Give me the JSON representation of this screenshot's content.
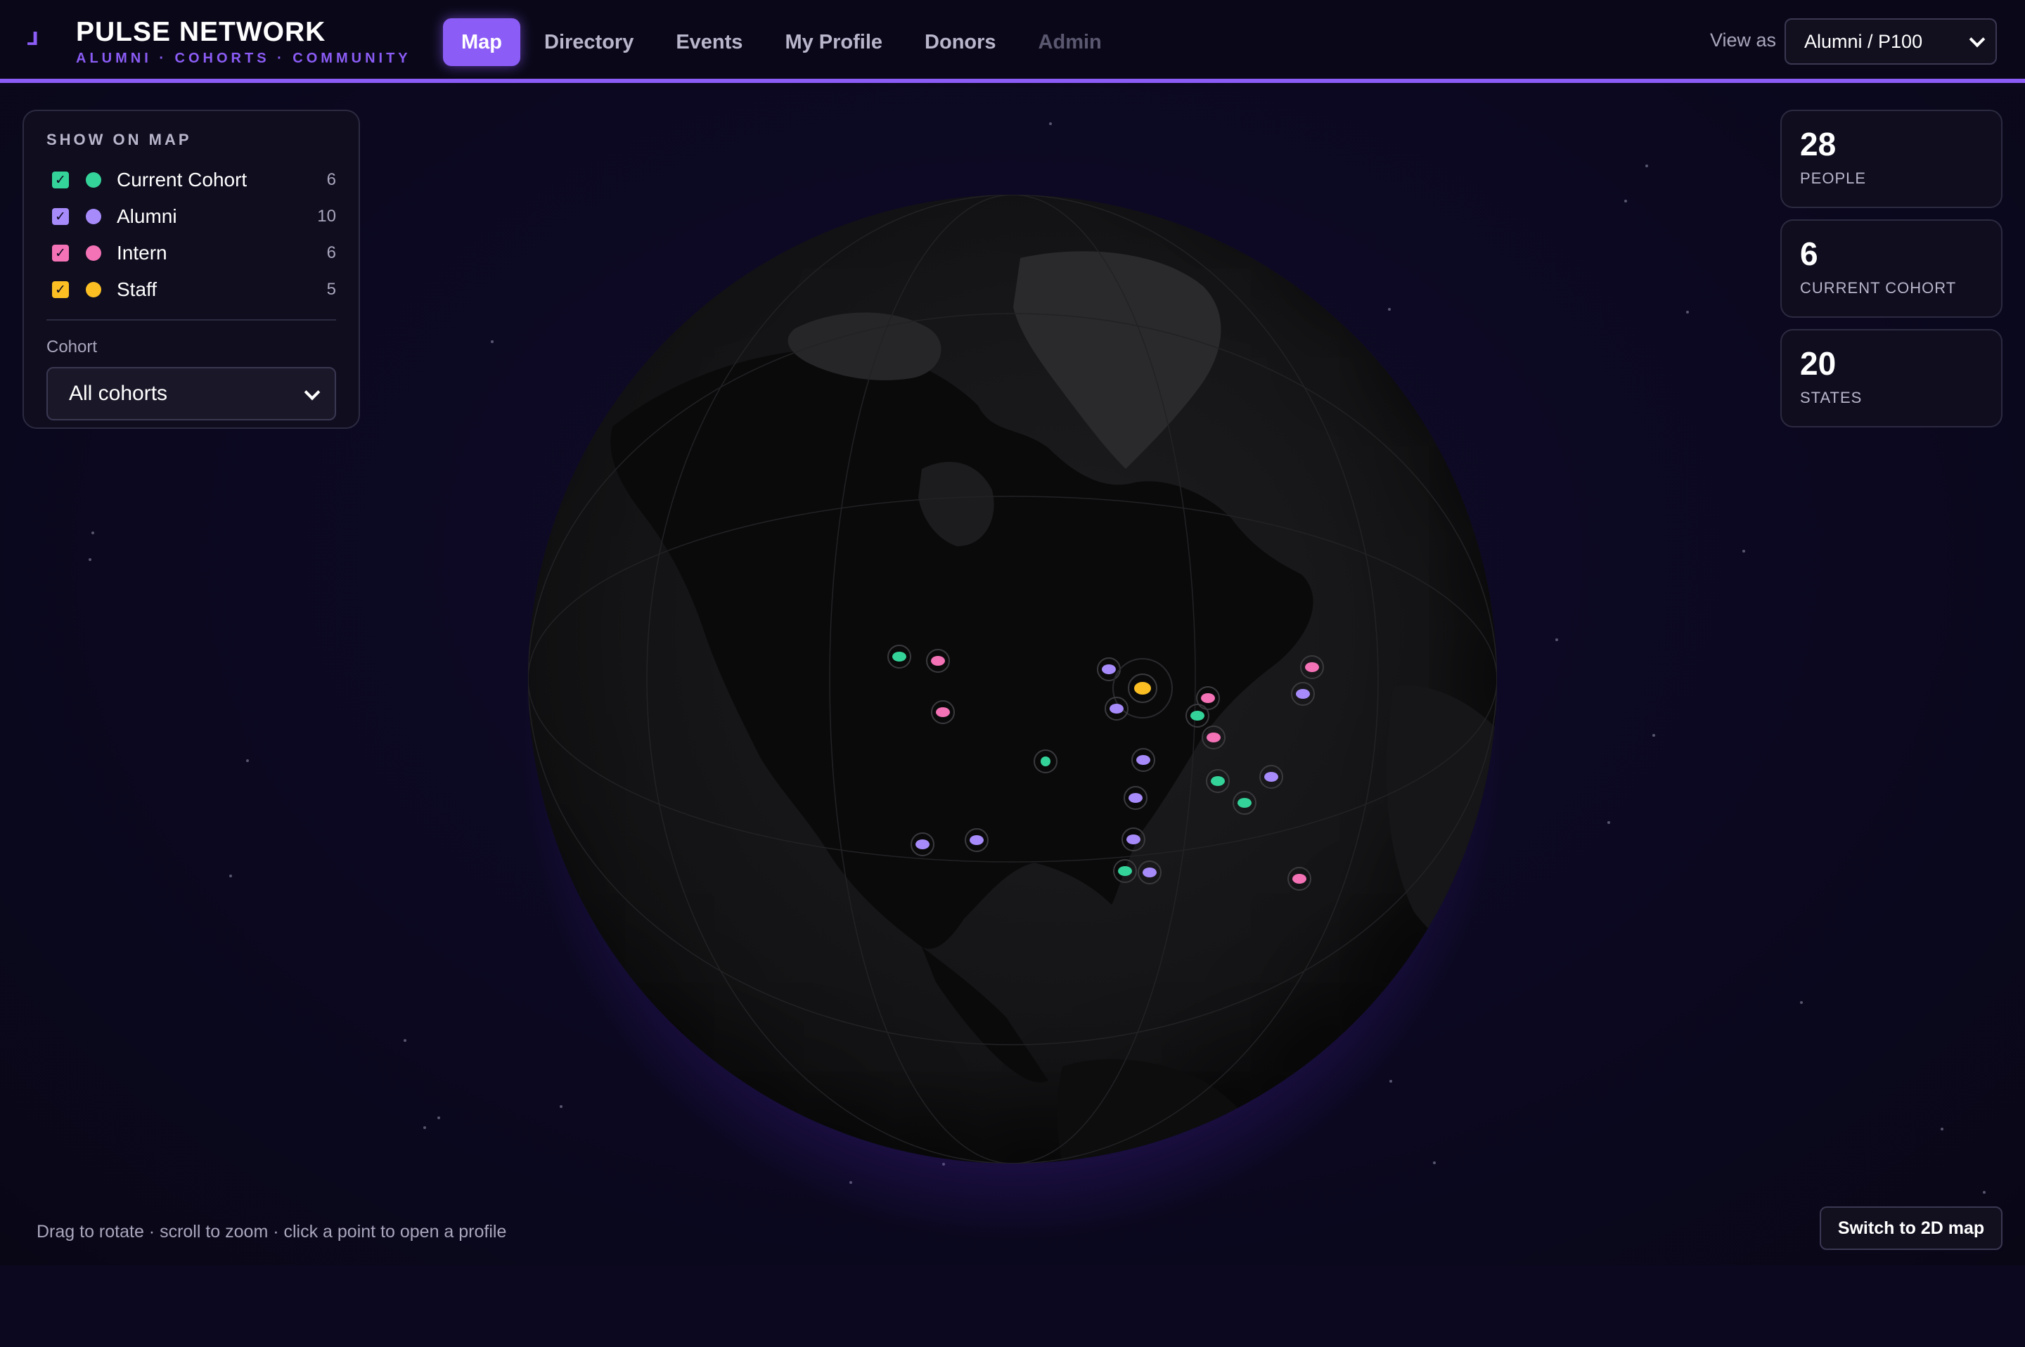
{
  "brand": {
    "title": "PULSE NETWORK",
    "subtitle": "ALUMNI · COHORTS · COMMUNITY"
  },
  "nav": [
    {
      "label": "Map",
      "state": "active"
    },
    {
      "label": "Directory",
      "state": "normal"
    },
    {
      "label": "Events",
      "state": "normal"
    },
    {
      "label": "My Profile",
      "state": "normal"
    },
    {
      "label": "Donors",
      "state": "normal"
    },
    {
      "label": "Admin",
      "state": "disabled"
    }
  ],
  "view_as": {
    "label": "View as",
    "selected": "Alumni / P100"
  },
  "filters": {
    "title": "SHOW ON MAP",
    "items": [
      {
        "label": "Current Cohort",
        "count": "6",
        "color": "#34d399",
        "checked": true
      },
      {
        "label": "Alumni",
        "count": "10",
        "color": "#a78bfa",
        "checked": true
      },
      {
        "label": "Intern",
        "count": "6",
        "color": "#f472b6",
        "checked": true
      },
      {
        "label": "Staff",
        "count": "5",
        "color": "#fbbf24",
        "checked": true
      }
    ],
    "cohort_label": "Cohort",
    "cohort_selected": "All cohorts"
  },
  "stats": [
    {
      "value": "28",
      "label": "PEOPLE"
    },
    {
      "value": "6",
      "label": "CURRENT COHORT"
    },
    {
      "value": "20",
      "label": "STATES"
    }
  ],
  "footer": {
    "hint": "Drag to rotate · scroll to zoom · click a point to open a profile",
    "switch_button": "Switch to 2D map"
  },
  "colors": {
    "accent": "#8b5cf6",
    "current_cohort": "#34d399",
    "alumni": "#a78bfa",
    "intern": "#f472b6",
    "staff": "#fbbf24"
  },
  "icons": {
    "logo": "pulse-logo-icon",
    "checkbox": "check-icon",
    "dropdown": "chevron-down-icon"
  },
  "markers": [
    {
      "group": "current_cohort",
      "label": "Current Cohort"
    },
    {
      "group": "intern",
      "label": "Intern"
    },
    {
      "group": "intern",
      "label": "Intern"
    },
    {
      "group": "alumni",
      "label": "Alumni"
    },
    {
      "group": "staff",
      "label": "Staff"
    },
    {
      "group": "alumni",
      "label": "Alumni"
    },
    {
      "group": "intern",
      "label": "Intern"
    },
    {
      "group": "current_cohort",
      "label": "Current Cohort"
    },
    {
      "group": "intern",
      "label": "Intern"
    },
    {
      "group": "intern",
      "label": "Intern"
    },
    {
      "group": "alumni",
      "label": "Alumni"
    },
    {
      "group": "current_cohort",
      "label": "Current Cohort"
    },
    {
      "group": "alumni",
      "label": "Alumni"
    },
    {
      "group": "alumni",
      "label": "Alumni"
    },
    {
      "group": "current_cohort",
      "label": "Current Cohort"
    },
    {
      "group": "alumni",
      "label": "Alumni"
    },
    {
      "group": "current_cohort",
      "label": "Current Cohort"
    },
    {
      "group": "alumni",
      "label": "Alumni"
    },
    {
      "group": "alumni",
      "label": "Alumni"
    },
    {
      "group": "alumni",
      "label": "Alumni"
    },
    {
      "group": "current_cohort",
      "label": "Current Cohort"
    },
    {
      "group": "alumni",
      "label": "Alumni"
    },
    {
      "group": "intern",
      "label": "Intern"
    }
  ]
}
